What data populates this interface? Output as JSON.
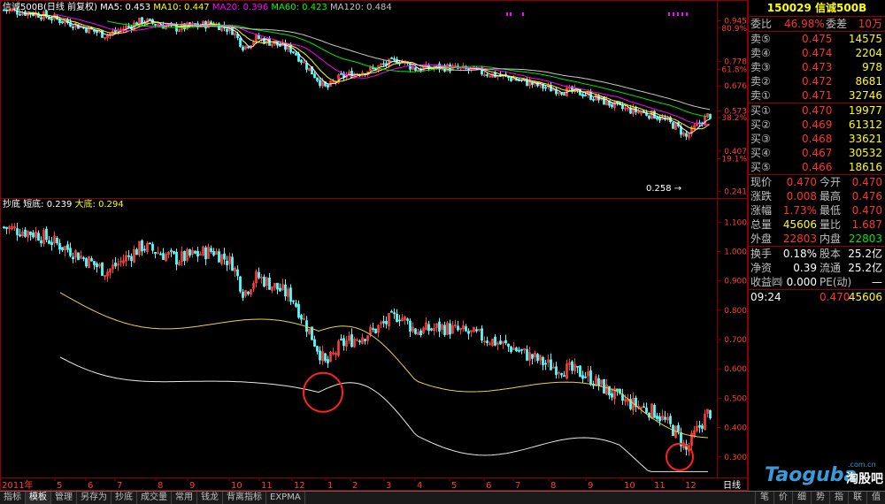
{
  "header": {
    "name": "信诚500B(日线 前复权)",
    "ma": [
      {
        "label": "MA5: 0.453",
        "color": "#ffffff"
      },
      {
        "label": "MA10: 0.447",
        "color": "#ffff00"
      },
      {
        "label": "MA20: 0.396",
        "color": "#ff00ff"
      },
      {
        "label": "MA60: 0.423",
        "color": "#00ff00"
      },
      {
        "label": "MA120: 0.484",
        "color": "#c0c0c0"
      }
    ]
  },
  "sub_header": {
    "name": "抄底",
    "items": [
      {
        "label": "短底: 0.239",
        "color": "#ffffff"
      },
      {
        "label": "大底: 0.294",
        "color": "#ffff00"
      }
    ]
  },
  "main_axis": {
    "ticks": [
      {
        "v": 0.945,
        "t": "0.945"
      },
      {
        "pct": "80.9%",
        "v": 0.915
      },
      {
        "v": 0.778,
        "t": "0.778"
      },
      {
        "pct": "61.8%",
        "v": 0.745
      },
      {
        "v": 0.676,
        "t": "0.676"
      },
      {
        "v": 0.573,
        "t": "0.573"
      },
      {
        "pct": "38.2%",
        "v": 0.545
      },
      {
        "v": 0.407,
        "t": "0.407"
      },
      {
        "pct": "19.1%",
        "v": 0.375
      },
      {
        "v": 0.241,
        "t": "0.241"
      }
    ],
    "low_label": "0.258"
  },
  "sub_axis": {
    "ticks": [
      "1.100",
      "1.000",
      "0.900",
      "0.800",
      "0.700",
      "0.600",
      "0.500",
      "0.400",
      "0.300"
    ]
  },
  "x_axis": {
    "year": "2011年",
    "months": [
      "5",
      "6",
      "7",
      "8",
      "9",
      "10",
      "11",
      "12",
      "1",
      "2",
      "3",
      "4",
      "5",
      "6",
      "7",
      "8",
      "9",
      "10",
      "11",
      "12"
    ],
    "period": "日线"
  },
  "quote": {
    "title": "150029 信诚500B",
    "weibi_label": "委比",
    "weibi_value": "46.98%",
    "weicha_label": "委差",
    "weicha_value": "10万",
    "sells": [
      {
        "l": "卖⑤",
        "p": "0.475",
        "v": "14575"
      },
      {
        "l": "卖④",
        "p": "0.474",
        "v": "2204"
      },
      {
        "l": "卖③",
        "p": "0.473",
        "v": "978"
      },
      {
        "l": "卖②",
        "p": "0.472",
        "v": "8681"
      },
      {
        "l": "卖①",
        "p": "0.471",
        "v": "32746"
      }
    ],
    "buys": [
      {
        "l": "买①",
        "p": "0.470",
        "v": "19977"
      },
      {
        "l": "买②",
        "p": "0.469",
        "v": "61312"
      },
      {
        "l": "买③",
        "p": "0.468",
        "v": "33621"
      },
      {
        "l": "买④",
        "p": "0.467",
        "v": "30532"
      },
      {
        "l": "买⑤",
        "p": "0.466",
        "v": "18616"
      }
    ],
    "stats": [
      {
        "l1": "现价",
        "v1": "0.470",
        "l2": "今开",
        "v2": "0.470",
        "c1": "red",
        "c2": "red"
      },
      {
        "l1": "涨跌",
        "v1": "0.008",
        "l2": "最高",
        "v2": "0.476",
        "c1": "red",
        "c2": "red"
      },
      {
        "l1": "涨幅",
        "v1": "1.73%",
        "l2": "最低",
        "v2": "0.470",
        "c1": "red",
        "c2": "red"
      },
      {
        "l1": "总量",
        "v1": "45606",
        "l2": "量比",
        "v2": "1.687",
        "c1": "yel",
        "c2": "red"
      },
      {
        "l1": "外盘",
        "v1": "22803",
        "l2": "内盘",
        "v2": "22803",
        "c1": "red",
        "c2": "grn"
      }
    ],
    "stats2": [
      {
        "l1": "换手",
        "v1": "0.18%",
        "l2": "股本",
        "v2": "25.2亿"
      },
      {
        "l1": "净资",
        "v1": "0.39",
        "l2": "流通",
        "v2": "25.2亿"
      },
      {
        "l1": "收益㈣",
        "v1": "0.000",
        "l2": "PE(动)",
        "v2": "—"
      }
    ],
    "tick": {
      "time": "09:24",
      "price": "0.470",
      "vol": "45606"
    }
  },
  "tabs": [
    "指标",
    "模板",
    "管理",
    "另存为",
    "抄底",
    "成交量",
    "常用",
    "钱龙",
    "背离指标",
    "EXPMA"
  ],
  "selected_tab": "模板",
  "right_tabs": [
    "笔",
    "价",
    "细",
    "势",
    "指",
    "联",
    "值"
  ],
  "watermark": {
    "brand": "Taoguba",
    "domain": ".com.cn",
    "cn": "淘股吧"
  }
}
